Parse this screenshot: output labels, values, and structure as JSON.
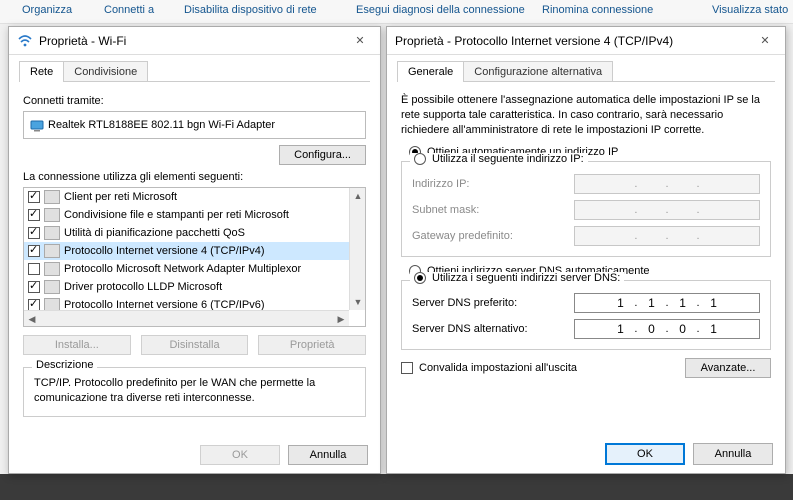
{
  "toolbar": {
    "items": [
      "Organizza",
      "Connetti a",
      "Disabilita dispositivo di rete",
      "Esegui diagnosi della connessione",
      "Rinomina connessione",
      "Visualizza stato"
    ]
  },
  "dlg1": {
    "title": "Proprietà - Wi-Fi",
    "tabs": {
      "rete": "Rete",
      "condivisione": "Condivisione"
    },
    "connect_label": "Connetti tramite:",
    "adapter": "Realtek RTL8188EE 802.11 bgn Wi-Fi Adapter",
    "configure_btn": "Configura...",
    "uses_label": "La connessione utilizza gli elementi seguenti:",
    "items": [
      {
        "checked": true,
        "label": "Client per reti Microsoft"
      },
      {
        "checked": true,
        "label": "Condivisione file e stampanti per reti Microsoft"
      },
      {
        "checked": true,
        "label": "Utilità di pianificazione pacchetti QoS"
      },
      {
        "checked": true,
        "label": "Protocollo Internet versione 4 (TCP/IPv4)"
      },
      {
        "checked": false,
        "label": "Protocollo Microsoft Network Adapter Multiplexor"
      },
      {
        "checked": true,
        "label": "Driver protocollo LLDP Microsoft"
      },
      {
        "checked": true,
        "label": "Protocollo Internet versione 6 (TCP/IPv6)"
      }
    ],
    "install_btn": "Installa...",
    "uninstall_btn": "Disinstalla",
    "props_btn": "Proprietà",
    "desc_title": "Descrizione",
    "desc_text": "TCP/IP. Protocollo predefinito per le WAN che permette la comunicazione tra diverse reti interconnesse.",
    "ok": "OK",
    "cancel": "Annulla"
  },
  "dlg2": {
    "title": "Proprietà - Protocollo Internet versione 4 (TCP/IPv4)",
    "tabs": {
      "general": "Generale",
      "alt": "Configurazione alternativa"
    },
    "intro": "È possibile ottenere l'assegnazione automatica delle impostazioni IP se la rete supporta tale caratteristica. In caso contrario, sarà necessario richiedere all'amministratore di rete le impostazioni IP corrette.",
    "ip_auto": "Ottieni automaticamente un indirizzo IP",
    "ip_manual": "Utilizza il seguente indirizzo IP:",
    "fields": {
      "ip": "Indirizzo IP:",
      "mask": "Subnet mask:",
      "gw": "Gateway predefinito:"
    },
    "dns_auto": "Ottieni indirizzo server DNS automaticamente",
    "dns_manual": "Utilizza i seguenti indirizzi server DNS:",
    "dns_pref": "Server DNS preferito:",
    "dns_alt": "Server DNS alternativo:",
    "dns1": [
      "1",
      "1",
      "1",
      "1"
    ],
    "dns2": [
      "1",
      "0",
      "0",
      "1"
    ],
    "validate": "Convalida impostazioni all'uscita",
    "advanced": "Avanzate...",
    "ok": "OK",
    "cancel": "Annulla"
  },
  "icons": {
    "close": "✕"
  }
}
